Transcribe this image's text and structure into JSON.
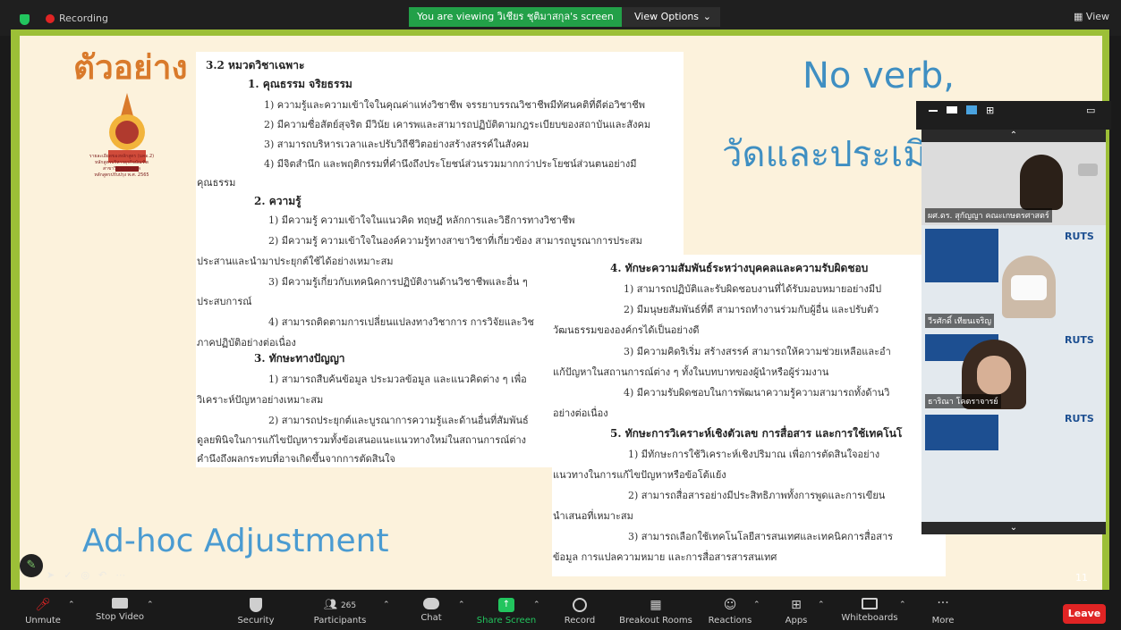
{
  "topbar": {
    "recording_label": "Recording",
    "viewing_text": "You are viewing วิเชียร ชุติมาสกุล's screen",
    "view_options_label": "View Options",
    "view_label": "View"
  },
  "slide": {
    "title": "ตัวอย่าง",
    "logo_caption": [
      "รายละเอียดของหลักสูตร (มคอ.2)",
      "หลักสูตรบริหารธุรกิจบัณฑิต",
      "สาขาวิชาการตลาด",
      "หลักสูตรปรับปรุง พ.ศ. 2565"
    ],
    "heading_no_verb": "No verb,",
    "heading_measure": "วัดและประเมิน",
    "ad_hoc": "Ad-hoc Adjustment",
    "page_number": "11",
    "left_column": [
      "3.2 หมวดวิชาเฉพาะ",
      "1. คุณธรรม จริยธรรม",
      "1) ความรู้และความเข้าใจในคุณค่าแห่งวิชาชีพ จรรยาบรรณวิชาชีพมีทัศนคติที่ดีต่อวิชาชีพ",
      "2) มีความซื่อสัตย์สุจริต มีวินัย เคารพและสามารถปฏิบัติตามกฎระเบียบของสถาบันและสังคม",
      "3) สามารถบริหารเวลาและปรับวิถีชีวิตอย่างสร้างสรรค์ในสังคม",
      "4) มีจิตสำนึก และพฤติกรรมที่คำนึงถึงประโยชน์ส่วนรวมมากกว่าประโยชน์ส่วนตนอย่างมี",
      "คุณธรรม",
      "2. ความรู้",
      "1) มีความรู้ ความเข้าใจในแนวคิด ทฤษฎี หลักการและวิธีการทางวิชาชีพ",
      "2) มีความรู้ ความเข้าใจในองค์ความรู้ทางสาขาวิชาที่เกี่ยวข้อง สามารถบูรณาการประสม",
      "ประสานและนำมาประยุกต์ใช้ได้อย่างเหมาะสม",
      "3) มีความรู้เกี่ยวกับเทคนิคการปฏิบัติงานด้านวิชาชีพและอื่น ๆ",
      "ประสบการณ์",
      "4) สามารถติดตามการเปลี่ยนแปลงทางวิชาการ การวิจัยและวิช",
      "ภาคปฏิบัติอย่างต่อเนื่อง",
      "3. ทักษะทางปัญญา",
      "1) สามารถสืบค้นข้อมูล ประมวลข้อมูล และแนวคิดต่าง ๆ เพื่อ",
      "วิเคราะห์ปัญหาอย่างเหมาะสม",
      "2) สามารถประยุกต์และบูรณาการความรู้และด้านอื่นที่สัมพันธ์",
      "ดูลยพินิจในการแก้ไขปัญหารวมทั้งข้อเสนอแนะแนวทางใหม่ในสถานการณ์ต่าง",
      "คำนึงถึงผลกระทบที่อาจเกิดขึ้นจากการตัดสินใจ"
    ],
    "right_column": [
      "4. ทักษะความสัมพันธ์ระหว่างบุคคลและความรับผิดชอบ",
      "1) สามารถปฏิบัติและรับผิดชอบงานที่ได้รับมอบหมายอย่างมีป",
      "2) มีมนุษยสัมพันธ์ที่ดี สามารถทำงานร่วมกับผู้อื่น และปรับตัว",
      "วัฒนธรรมขององค์กรได้เป็นอย่างดี",
      "3) มีความคิดริเริ่ม สร้างสรรค์ สามารถให้ความช่วยเหลือและอำ",
      "แก้ปัญหาในสถานการณ์ต่าง ๆ ทั้งในบทบาทของผู้นำหรือผู้ร่วมงาน",
      "4) มีความรับผิดชอบในการพัฒนาความรู้ความสามารถทั้งด้านวิ",
      "อย่างต่อเนื่อง",
      "5. ทักษะการวิเคราะห์เชิงตัวเลข การสื่อสาร และการใช้เทคโนโ",
      "1) มีทักษะการใช้วิเคราะห์เชิงปริมาณ เพื่อการตัดสินใจอย่าง",
      "แนวทางในการแก้ไขปัญหาหรือข้อโต้แย้ง",
      "2) สามารถสื่อสารอย่างมีประสิทธิภาพทั้งการพูดและการเขียน",
      "นำเสนอที่เหมาะสม",
      "3) สามารถเลือกใช้เทคโนโลยีสารสนเทศและเทคนิคการสื่อสาร",
      "ข้อมูล การแปลความหมาย และการสื่อสารสารสนเทศ"
    ]
  },
  "participants_panel": {
    "videos": [
      {
        "name": "ผศ.ดร. สุกัญญา คณะเกษตรศาสตร์"
      },
      {
        "name": "วีรศักดิ์ เทียนเจริญ",
        "badge": "RUTS"
      },
      {
        "name": "ธาริณา โคตราจารย์",
        "badge": "RUTS"
      },
      {
        "badge": "RUTS"
      }
    ]
  },
  "toolbar": {
    "unmute": "Unmute",
    "stop_video": "Stop Video",
    "security": "Security",
    "participants": "Participants",
    "participants_count": "265",
    "chat": "Chat",
    "share_screen": "Share Screen",
    "record": "Record",
    "breakout": "Breakout Rooms",
    "reactions": "Reactions",
    "apps": "Apps",
    "whiteboards": "Whiteboards",
    "more": "More",
    "leave": "Leave"
  }
}
